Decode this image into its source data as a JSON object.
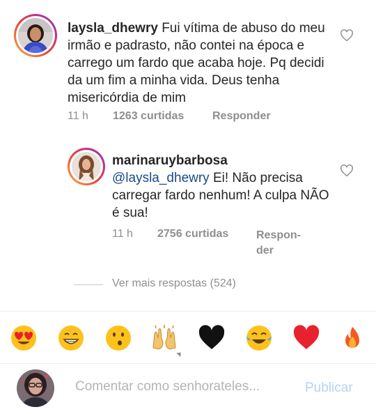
{
  "comments": [
    {
      "username": "laysla_dhewry",
      "text": "Fui vítima de abuso do meu irmão e padrasto, não contei na época e carrego um fardo que acaba hoje. Pq decidi da um fim a minha vida. Deus tenha misericórdia de mim",
      "time": "11 h",
      "likes": "1263 curtidas",
      "reply": "Responder"
    }
  ],
  "reply": {
    "username": "marinaruybarbosa",
    "mention": "@laysla_dhewry",
    "text": "Ei! Não precisa carregar fardo nenhum! A culpa NÃO é sua!",
    "time": "11 h",
    "likes": "2756 curtidas",
    "reply_line1": "Respon-",
    "reply_line2": "der"
  },
  "more_replies": "Ver mais respostas (524)",
  "emojis": [
    "heart-eyes",
    "grinning",
    "surprised",
    "raised-hands",
    "black-heart",
    "tears-of-joy",
    "red-heart",
    "fire"
  ],
  "compose": {
    "placeholder": "Comentar como senhorateles...",
    "publish": "Publicar"
  },
  "colors": {
    "text": "#262626",
    "muted": "#8e8e8e",
    "mention": "#1a4a8c",
    "publish": "#b3d3f3"
  }
}
